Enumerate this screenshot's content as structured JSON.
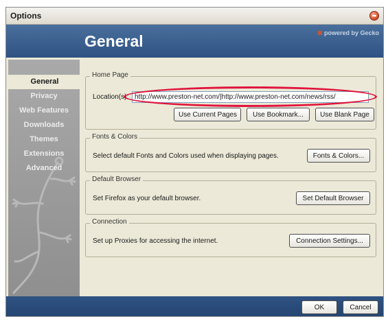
{
  "window": {
    "title": "Options"
  },
  "header": {
    "title": "General",
    "powered_by": "powered by Gecko"
  },
  "sidebar": {
    "items": [
      {
        "label": "General",
        "active": true
      },
      {
        "label": "Privacy"
      },
      {
        "label": "Web Features"
      },
      {
        "label": "Downloads"
      },
      {
        "label": "Themes"
      },
      {
        "label": "Extensions"
      },
      {
        "label": "Advanced"
      }
    ]
  },
  "home_page": {
    "legend": "Home Page",
    "location_label": "Location(s):",
    "location_value": "http://www.preston-net.com/|http://www.preston-net.com/news/rss/",
    "use_current_label": "Use Current Pages",
    "use_bookmark_label": "Use Bookmark...",
    "use_blank_label": "Use Blank Page"
  },
  "fonts_colors": {
    "legend": "Fonts & Colors",
    "description": "Select default Fonts and Colors used when displaying pages.",
    "button_label": "Fonts & Colors..."
  },
  "default_browser": {
    "legend": "Default Browser",
    "description": "Set Firefox as your default browser.",
    "button_label": "Set Default Browser"
  },
  "connection": {
    "legend": "Connection",
    "description": "Set up Proxies for accessing the internet.",
    "button_label": "Connection Settings..."
  },
  "footer": {
    "ok_label": "OK",
    "cancel_label": "Cancel"
  },
  "colors": {
    "header_blue": "#2e5283",
    "highlight_red": "#e0143c",
    "dialog_bg": "#ece9d8"
  }
}
